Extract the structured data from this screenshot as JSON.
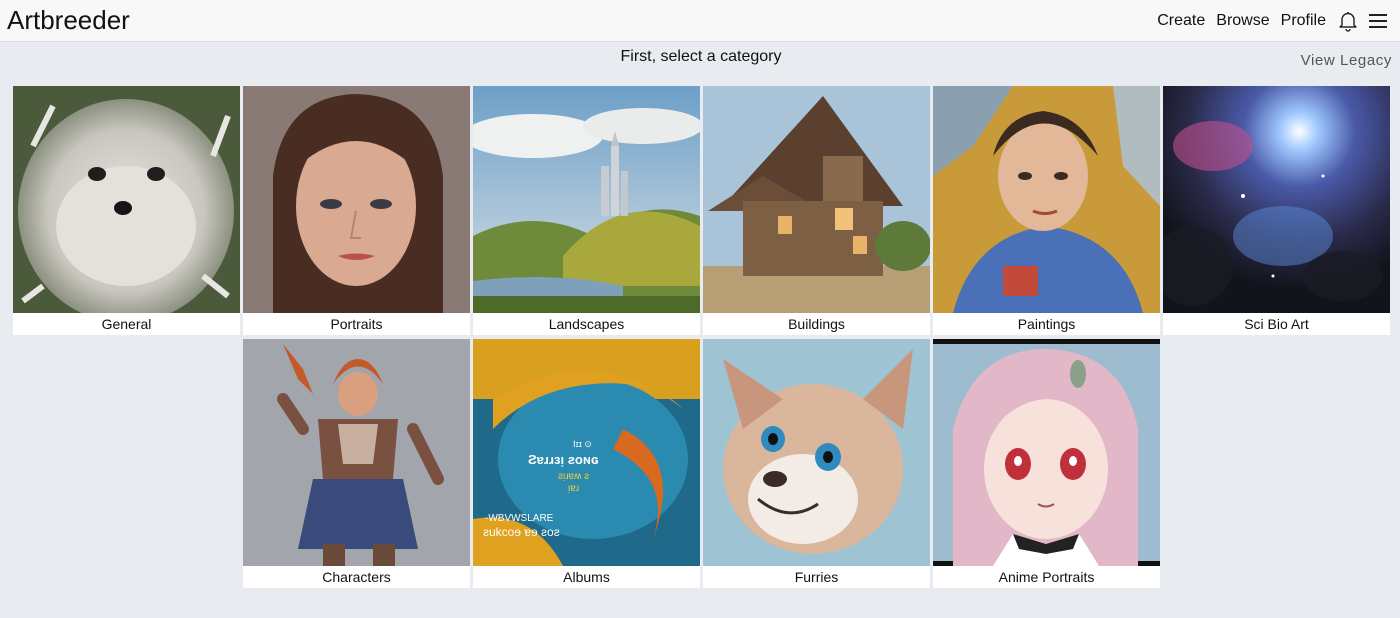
{
  "header": {
    "logo": "Artbreeder",
    "nav": [
      {
        "label": "Create"
      },
      {
        "label": "Browse"
      },
      {
        "label": "Profile"
      }
    ],
    "icons": [
      "bell-icon",
      "menu-icon"
    ]
  },
  "main": {
    "prompt": "First, select a category",
    "legacy_link": "View Legacy"
  },
  "categories": [
    {
      "label": "General"
    },
    {
      "label": "Portraits"
    },
    {
      "label": "Landscapes"
    },
    {
      "label": "Buildings"
    },
    {
      "label": "Paintings"
    },
    {
      "label": "Sci Bio Art"
    },
    {
      "label": "Characters"
    },
    {
      "label": "Albums",
      "art_text": [
        "Iɪɪ ⊙",
        "Ƨɐɹɹɜᴉ ƨoɴɢ",
        "ƨᴉɹɐʍ ƨ",
        "ᴉɐɹ",
        "-WBVWSLARE",
        "ƨukcoɘ ɐɘ ƨoƨ"
      ]
    },
    {
      "label": "Furries"
    },
    {
      "label": "Anime Portraits"
    }
  ],
  "colors": {
    "background": "#e8ebf0",
    "navbar": "#f8f8f9",
    "card": "#ffffff"
  }
}
